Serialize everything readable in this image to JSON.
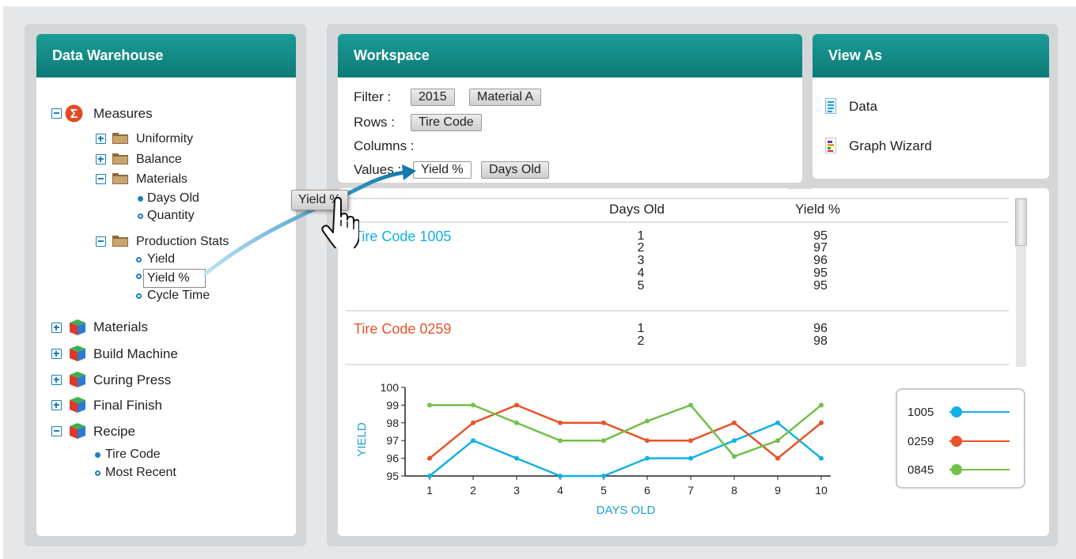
{
  "data_warehouse": {
    "title": "Data Warehouse",
    "measures": {
      "label": "Measures",
      "items": {
        "uniformity": "Uniformity",
        "balance": "Balance",
        "materials": "Materials",
        "days_old": "Days Old",
        "quantity": "Quantity",
        "production_stats": "Production Stats",
        "yield": "Yield",
        "yield_pct": "Yield %",
        "cycle_time": "Cycle Time"
      }
    },
    "dimensions": {
      "materials": "Materials",
      "build_machine": "Build Machine",
      "curing_press": "Curing Press",
      "final_finish": "Final Finish",
      "recipe": "Recipe",
      "tire_code": "Tire Code",
      "most_recent": "Most Recent"
    }
  },
  "workspace": {
    "title": "Workspace",
    "filter_label": "Filter :",
    "filters": [
      "2015",
      "Material A"
    ],
    "rows_label": "Rows :",
    "rows": [
      "Tire Code"
    ],
    "columns_label": "Columns :",
    "values_label": "Values :",
    "values": [
      "Yield %",
      "Days Old"
    ],
    "drag_chip": "Yield %"
  },
  "view_as": {
    "title": "View As",
    "options": [
      "Data",
      "Graph Wizard"
    ]
  },
  "table": {
    "headers": [
      "Days Old",
      "Yield %"
    ],
    "groups": [
      {
        "name": "Tire Code 1005",
        "days": [
          "1",
          "2",
          "3",
          "4",
          "5"
        ],
        "yields": [
          "95",
          "97",
          "96",
          "95",
          "95"
        ]
      },
      {
        "name": "Tire Code 0259",
        "days": [
          "1",
          "2"
        ],
        "yields": [
          "96",
          "98"
        ]
      }
    ]
  },
  "colors": {
    "teal": "#1a9c97",
    "blue": "#13b0e6",
    "red": "#e8532a",
    "green": "#72c04a"
  },
  "chart_data": {
    "type": "line",
    "xlabel": "DAYS OLD",
    "ylabel": "YIELD",
    "x": [
      1,
      2,
      3,
      4,
      5,
      6,
      7,
      8,
      9,
      10
    ],
    "ylim": [
      95,
      100
    ],
    "yticks": [
      95,
      96,
      97,
      98,
      99,
      100
    ],
    "series": [
      {
        "name": "1005",
        "color": "#13b0e6",
        "values": [
          95,
          97,
          96,
          95,
          95,
          96,
          96,
          97,
          98,
          96
        ]
      },
      {
        "name": "0259",
        "color": "#e8532a",
        "values": [
          96,
          98,
          99,
          98,
          98,
          97,
          97,
          98,
          96,
          98
        ]
      },
      {
        "name": "0845",
        "color": "#72c04a",
        "values": [
          99,
          99,
          98,
          97,
          97,
          98.1,
          99,
          96.1,
          97,
          99
        ]
      }
    ],
    "grid": false,
    "legend": "right"
  }
}
